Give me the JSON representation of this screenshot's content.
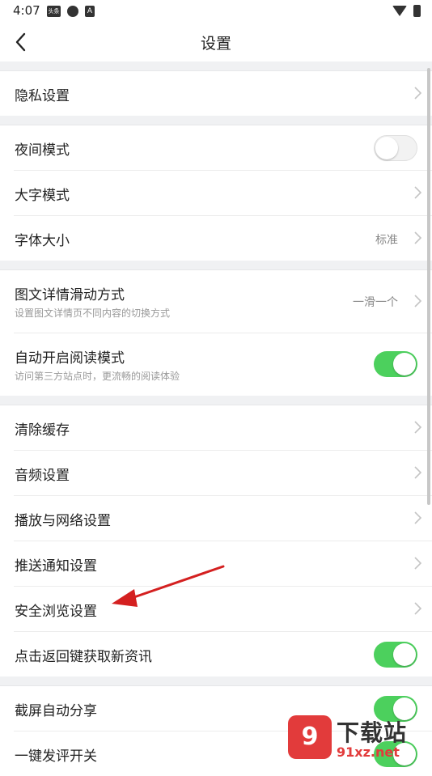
{
  "status": {
    "time": "4:07",
    "icons": [
      "toutiao-icon",
      "app-icon",
      "a-icon"
    ],
    "icon_text": "头条",
    "a_text": "A"
  },
  "nav": {
    "title": "设置"
  },
  "sections": [
    {
      "rows": [
        {
          "label": "隐私设置",
          "type": "chevron"
        }
      ]
    },
    {
      "rows": [
        {
          "label": "夜间模式",
          "type": "toggle",
          "on": false
        },
        {
          "label": "大字模式",
          "type": "chevron"
        },
        {
          "label": "字体大小",
          "type": "chevron",
          "value": "标准"
        }
      ]
    },
    {
      "rows": [
        {
          "label": "图文详情滑动方式",
          "sublabel": "设置图文详情页不同内容的切换方式",
          "type": "chevron",
          "value": "一滑一个"
        },
        {
          "label": "自动开启阅读模式",
          "sublabel": "访问第三方站点时，更流畅的阅读体验",
          "type": "toggle",
          "on": true
        }
      ]
    },
    {
      "rows": [
        {
          "label": "清除缓存",
          "type": "chevron"
        },
        {
          "label": "音频设置",
          "type": "chevron"
        },
        {
          "label": "播放与网络设置",
          "type": "chevron"
        },
        {
          "label": "推送通知设置",
          "type": "chevron"
        },
        {
          "label": "安全浏览设置",
          "type": "chevron"
        },
        {
          "label": "点击返回键获取新资讯",
          "type": "toggle",
          "on": true
        }
      ]
    },
    {
      "rows": [
        {
          "label": "截屏自动分享",
          "type": "toggle",
          "on": true
        },
        {
          "label": "一键发评开关",
          "type": "toggle",
          "on": true
        }
      ]
    }
  ],
  "watermark": {
    "logo": "9",
    "text": "下载站",
    "url": "91xz.net"
  },
  "colors": {
    "toggle_on": "#4cd05d",
    "arrow": "#d42020",
    "watermark_red": "#e23b3b"
  }
}
